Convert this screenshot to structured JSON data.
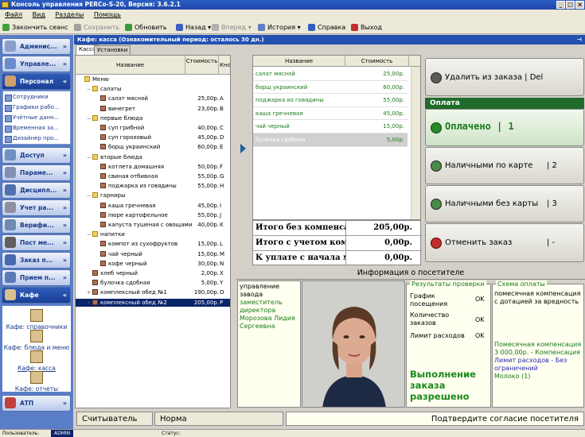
{
  "window": {
    "title": "Консоль управления PERCo-S-20, Версия: 3.6.2.1"
  },
  "menu": [
    "Файл",
    "Вид",
    "Разделы",
    "Помощь"
  ],
  "toolbar": {
    "save_session": "Закончить сеанс",
    "save": "Сохранить",
    "refresh": "Обновить",
    "back": "Назад",
    "forward": "Вперед",
    "history": "История",
    "help": "Справка",
    "exit": "Выход"
  },
  "sidebar": {
    "sections": [
      "Админис...",
      "Управле...",
      "Персонал",
      "Доступ",
      "Параме...",
      "Дисципл...",
      "Учет ра...",
      "Верифи...",
      "Пост ме...",
      "Заказ п...",
      "Прием п...",
      "Кафе",
      "АТП"
    ],
    "personnel_items": [
      "Сотрудники",
      "Графики рабо...",
      "Учётные данн...",
      "Временная за...",
      "Дизайнер про..."
    ],
    "cafe_items": [
      "Кафе: справочники",
      "Кафе: блюда и меню",
      "Кафе: касса",
      "Кафе: отчеты"
    ]
  },
  "document": {
    "header": "Кафе: касса (Ознакомительный период: осталось 30 дн.)",
    "tabs": [
      "Касса",
      "Установки"
    ]
  },
  "menu_table": {
    "columns": [
      "Название",
      "Стоимость",
      "Кно"
    ],
    "rows": [
      {
        "level": 0,
        "kind": "folder",
        "toggle": "",
        "name": "Меню",
        "price": "",
        "key": ""
      },
      {
        "level": 1,
        "kind": "folder",
        "toggle": "−",
        "name": "салаты",
        "price": "",
        "key": ""
      },
      {
        "level": 2,
        "kind": "dish",
        "toggle": "",
        "name": "салат мясной",
        "price": "25,00р.",
        "key": "A"
      },
      {
        "level": 2,
        "kind": "dish",
        "toggle": "",
        "name": "винегрет",
        "price": "23,00р.",
        "key": "B"
      },
      {
        "level": 1,
        "kind": "folder",
        "toggle": "−",
        "name": "первые блюда",
        "price": "",
        "key": ""
      },
      {
        "level": 2,
        "kind": "dish",
        "toggle": "",
        "name": "суп грибной",
        "price": "40,00р.",
        "key": "C"
      },
      {
        "level": 2,
        "kind": "dish",
        "toggle": "",
        "name": "суп гороховый",
        "price": "45,00р.",
        "key": "D"
      },
      {
        "level": 2,
        "kind": "dish",
        "toggle": "",
        "name": "борщ украинский",
        "price": "60,00р.",
        "key": "E"
      },
      {
        "level": 1,
        "kind": "folder",
        "toggle": "−",
        "name": "вторые блюда",
        "price": "",
        "key": ""
      },
      {
        "level": 2,
        "kind": "dish",
        "toggle": "",
        "name": "котлета домашняя",
        "price": "50,00р.",
        "key": "F"
      },
      {
        "level": 2,
        "kind": "dish",
        "toggle": "",
        "name": "свиная отбивная",
        "price": "55,00р.",
        "key": "G"
      },
      {
        "level": 2,
        "kind": "dish",
        "toggle": "",
        "name": "поджарка из говядины",
        "price": "55,00р.",
        "key": "H"
      },
      {
        "level": 1,
        "kind": "folder",
        "toggle": "−",
        "name": "гарниры",
        "price": "",
        "key": ""
      },
      {
        "level": 2,
        "kind": "dish",
        "toggle": "",
        "name": "каша гречневая",
        "price": "45,00р.",
        "key": "I"
      },
      {
        "level": 2,
        "kind": "dish",
        "toggle": "",
        "name": "пюре картофельное",
        "price": "55,00р.",
        "key": "J"
      },
      {
        "level": 2,
        "kind": "dish",
        "toggle": "",
        "name": "капуста тушеная с овощами",
        "price": "40,00р.",
        "key": "K"
      },
      {
        "level": 1,
        "kind": "folder",
        "toggle": "−",
        "name": "напитки",
        "price": "",
        "key": ""
      },
      {
        "level": 2,
        "kind": "dish",
        "toggle": "",
        "name": "компот из сухофруктов",
        "price": "15,00р.",
        "key": "L"
      },
      {
        "level": 2,
        "kind": "dish",
        "toggle": "",
        "name": "чай черный",
        "price": "15,00р.",
        "key": "M"
      },
      {
        "level": 2,
        "kind": "dish",
        "toggle": "",
        "name": "кофе черный",
        "price": "30,00р.",
        "key": "N"
      },
      {
        "level": 1,
        "kind": "dish",
        "toggle": "",
        "name": "хлеб черный",
        "price": "2,00р.",
        "key": "X"
      },
      {
        "level": 1,
        "kind": "dish",
        "toggle": "",
        "name": "булочка сдобная",
        "price": "5,00р.",
        "key": "Y"
      },
      {
        "level": 1,
        "kind": "dish",
        "toggle": "+",
        "name": "комплексный обед №1",
        "price": "190,00р.",
        "key": "O"
      },
      {
        "level": 1,
        "kind": "dish",
        "toggle": "+",
        "name": "комплексный обед №2",
        "price": "205,00р.",
        "key": "P",
        "selected": true
      }
    ]
  },
  "order_table": {
    "columns": [
      "Название",
      "Стоимость"
    ],
    "rows": [
      {
        "name": "салат мясной",
        "price": "25,00р."
      },
      {
        "name": "борщ украинский",
        "price": "60,00р."
      },
      {
        "name": "поджарка из говядины",
        "price": "55,00р."
      },
      {
        "name": "каша гречневая",
        "price": "45,00р."
      },
      {
        "name": "чай черный",
        "price": "15,00р."
      },
      {
        "name": "булочка сдобная",
        "price": "5,00р.",
        "selected": true
      }
    ]
  },
  "totals": [
    {
      "label": "Итого без компенсации",
      "value": "205,00р."
    },
    {
      "label": "Итого с учетом компенсации",
      "value": "0,00р."
    },
    {
      "label": "К уплате с начала месяца",
      "value": "0,00р."
    }
  ],
  "actions": {
    "remove": "Удалить из заказа | Del",
    "payment_header": "Оплата",
    "paid": "Оплачено | 1",
    "card": "Наличными по карте",
    "card_key": "| 2",
    "nocard": "Наличными без карты",
    "nocard_key": "| 3",
    "cancel": "Отменить заказ",
    "cancel_key": "| -"
  },
  "visitor": {
    "header": "Информация о посетителе",
    "department": "управление завода",
    "position": "заместитель директора",
    "name": "Морозова Лидия Сергеевна",
    "checks_title": "Результаты проверки",
    "checks": [
      {
        "label": "График посещения",
        "value": "OK"
      },
      {
        "label": "Количество заказов",
        "value": "OK"
      },
      {
        "label": "Лимит расходов",
        "value": "OK"
      }
    ],
    "result": "Выполнение заказа разрешено",
    "scheme_title": "Схема оплаты",
    "scheme_text": "помесячная компенсация с дотацией за вредность",
    "scheme_comp": "Помесячная компенсация 3 000,00р. - Компенсация",
    "scheme_limit": "Лимит расходов - Без ограничений",
    "scheme_milk": "Молоко (1)"
  },
  "statusbar": {
    "reader": "Считыватель",
    "state": "Норма",
    "prompt": "Подтвердите согласие посетителя"
  },
  "bottombar": {
    "user_label": "Пользователь:",
    "user": "ADMIN",
    "status_label": "Статус:"
  },
  "colors": {
    "accent": "#2251b0",
    "sidebar": "#5a7dc7",
    "ok_green": "#1a7a1a",
    "payment": "#1f6b2a"
  }
}
